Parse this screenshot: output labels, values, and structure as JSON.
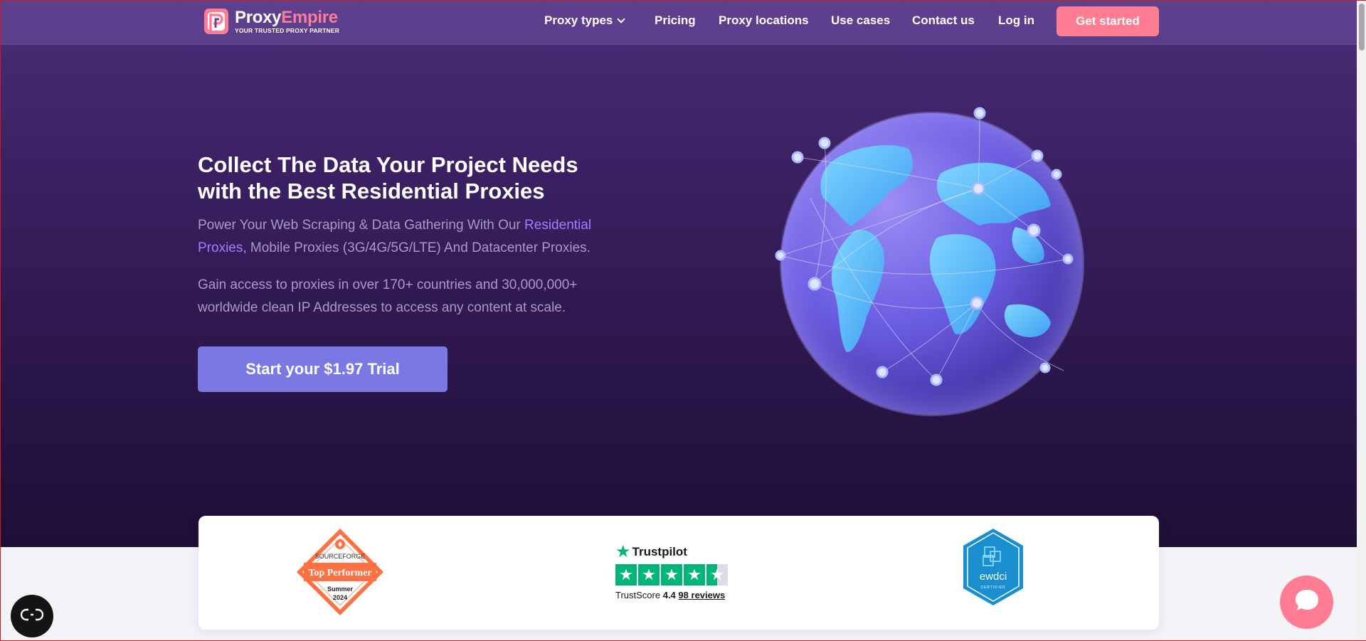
{
  "brand": {
    "name_part1": "Proxy",
    "name_part2": "Empire",
    "tagline": "YOUR TRUSTED PROXY PARTNER",
    "accent_color": "#ff7c92"
  },
  "nav": {
    "items": [
      {
        "label": "Proxy types",
        "has_dropdown": true
      },
      {
        "label": "Pricing"
      },
      {
        "label": "Proxy locations"
      },
      {
        "label": "Use cases"
      },
      {
        "label": "Contact us"
      },
      {
        "label": "Log in"
      }
    ],
    "cta_label": "Get started"
  },
  "hero": {
    "headline_line1": "Collect The Data Your Project Needs",
    "headline_line2": "with the Best Residential Proxies",
    "sub1_before": "Power Your Web Scraping & Data Gathering With Our ",
    "sub1_link": "Residential Proxies",
    "sub1_after": ", Mobile Proxies (3G/4G/5G/LTE) And Datacenter Proxies.",
    "sub2": "Gain access to proxies in over 170+ countries and 30,000,000+ worldwide clean IP Addresses to access any content at scale.",
    "trial_button": "Start your $1.97 Trial",
    "trial_button_color": "#7a78e3"
  },
  "badges": {
    "sourceforge": {
      "brand": "SOURCEFORGE",
      "title": "Top Performer",
      "season": "Summer",
      "year": "2024"
    },
    "trustpilot": {
      "name": "Trustpilot",
      "score_label": "TrustScore",
      "score": "4.4",
      "reviews_count": "98",
      "reviews_label": "reviews",
      "rating": 4.4
    },
    "ewdci": {
      "name": "ewdci",
      "subtitle": "CERTIFIED"
    }
  },
  "floating": {
    "privacy_icon": "privacy-settings-icon",
    "chat_icon": "chat-bubble-icon"
  }
}
